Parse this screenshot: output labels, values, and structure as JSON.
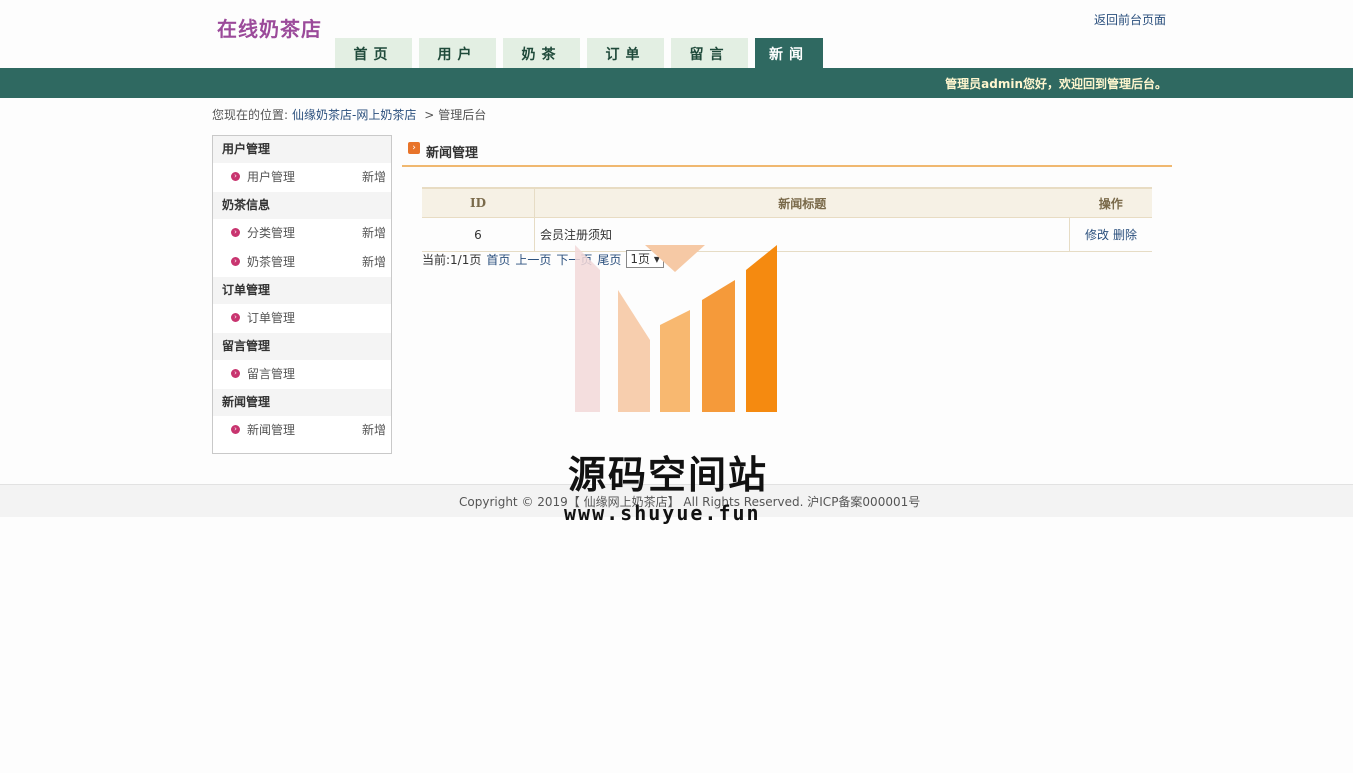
{
  "header": {
    "logo": "在线奶茶店",
    "back_link": "返回前台页面",
    "welcome": "管理员admin您好，欢迎回到管理后台。"
  },
  "nav": {
    "tabs": [
      {
        "label": "首页"
      },
      {
        "label": "用户"
      },
      {
        "label": "奶茶"
      },
      {
        "label": "订单"
      },
      {
        "label": "留言"
      },
      {
        "label": "新闻",
        "active": true
      }
    ]
  },
  "breadcrumb": {
    "prefix": "您现在的位置:",
    "site": "仙缘奶茶店-网上奶茶店",
    "sep": ">",
    "current": "管理后台"
  },
  "sidebar": {
    "groups": [
      {
        "title": "用户管理",
        "items": [
          {
            "label": "用户管理",
            "action": "新增"
          }
        ]
      },
      {
        "title": "奶茶信息",
        "items": [
          {
            "label": "分类管理",
            "action": "新增"
          },
          {
            "label": "奶茶管理",
            "action": "新增"
          }
        ]
      },
      {
        "title": "订单管理",
        "items": [
          {
            "label": "订单管理",
            "action": ""
          }
        ]
      },
      {
        "title": "留言管理",
        "items": [
          {
            "label": "留言管理",
            "action": ""
          }
        ]
      },
      {
        "title": "新闻管理",
        "items": [
          {
            "label": "新闻管理",
            "action": "新增"
          }
        ]
      }
    ]
  },
  "main": {
    "title": "新闻管理",
    "table": {
      "headers": [
        "ID",
        "新闻标题",
        "操作"
      ],
      "rows": [
        {
          "id": "6",
          "title": "会员注册须知",
          "edit": "修改",
          "delete": "删除"
        }
      ]
    },
    "pager": {
      "current": "当前:1/1页",
      "first": "首页",
      "prev": "上一页",
      "next": "下一页",
      "last": "尾页",
      "select": "1页"
    }
  },
  "footer": {
    "copyright": "Copyright © 2019【 仙缘网上奶茶店】 All Rights Reserved. 沪ICP备案000001号"
  },
  "watermark": {
    "text": "源码空间站",
    "url": "www.shuyue.fun",
    "colors": [
      "#f2d0d0",
      "#f6c9a5",
      "#f8b870",
      "#f59a3a",
      "#f58a10"
    ]
  }
}
